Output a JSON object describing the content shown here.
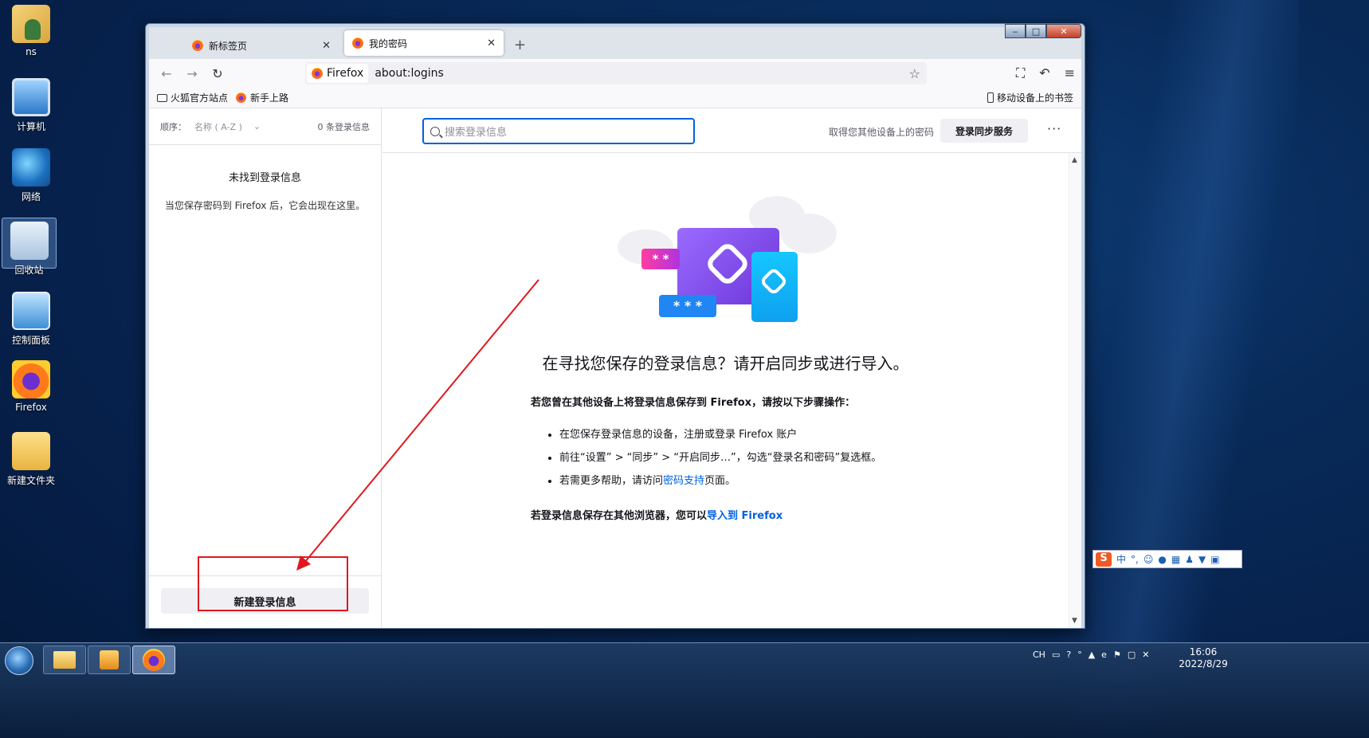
{
  "desktop": {
    "icons": [
      {
        "label": "ns"
      },
      {
        "label": "计算机"
      },
      {
        "label": "网络"
      },
      {
        "label": "回收站"
      },
      {
        "label": "控制面板"
      },
      {
        "label": "Firefox"
      },
      {
        "label": "新建文件夹"
      }
    ]
  },
  "browser": {
    "tabs": [
      {
        "label": "新标签页",
        "close": "✕"
      },
      {
        "label": "我的密码",
        "close": "✕"
      }
    ],
    "new_tab": "+",
    "window_controls": {
      "min": "‒",
      "max": "□",
      "close": "✕"
    },
    "nav": {
      "back": "←",
      "forward": "→",
      "reload": "↻"
    },
    "identity_label": "Firefox",
    "url": "about:logins",
    "star": "☆",
    "tools": {
      "screenshot": "⛶",
      "undo": "↶",
      "menu": "≡"
    },
    "bookmarks": [
      {
        "label": "火狐官方站点"
      },
      {
        "label": "新手上路"
      }
    ],
    "mobile_bookmarks": "移动设备上的书签"
  },
  "sidebar": {
    "sort_label": "顺序：",
    "sort_value": "名称 ( A-Z )",
    "sort_chevron": "⌄",
    "count": "0 条登录信息",
    "empty_title": "未找到登录信息",
    "empty_desc": "当您保存密码到 Firefox 后，它会出现在这里。",
    "new_login_button": "新建登录信息"
  },
  "main": {
    "search_placeholder": "搜索登录信息",
    "sync_prompt": "取得您其他设备上的密码",
    "sync_button": "登录同步服务",
    "more": "···",
    "illus_pw1": "* *",
    "illus_pw2": "* * *",
    "headline": "在寻找您保存的登录信息？请开启同步或进行导入。",
    "lead": "若您曾在其他设备上将登录信息保存到 Firefox，请按以下步骤操作：",
    "steps": [
      "在您保存登录信息的设备，注册或登录 Firefox 账户",
      "前往“设置” > “同步” > “开启同步…”，勾选“登录名和密码”复选框。"
    ],
    "help_prefix": "若需更多帮助，请访问",
    "help_link": "密码支持",
    "help_suffix": "页面。",
    "import_prefix": "若登录信息保存在其他浏览器，您可以",
    "import_link": "导入到 Firefox"
  },
  "ime": {
    "logo": "S",
    "mode": "中",
    "punct": "°,"
  },
  "taskbar": {
    "tray_lang": "CH",
    "time": "16:06",
    "date": "2022/8/29"
  },
  "colors": {
    "accent": "#0061e0",
    "annotation": "#e0181e"
  }
}
